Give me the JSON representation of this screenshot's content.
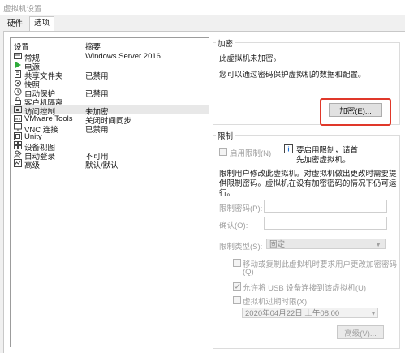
{
  "window": {
    "title": "虚拟机设置"
  },
  "tabs": [
    {
      "label": "硬件"
    },
    {
      "label": "选项"
    }
  ],
  "device_list": {
    "headers": {
      "setting": "设置",
      "summary": "摘要"
    },
    "items": [
      {
        "name": "常规",
        "summary": "Windows Server 2016",
        "icon": "general-icon"
      },
      {
        "name": "电源",
        "summary": "",
        "icon": "power-icon"
      },
      {
        "name": "共享文件夹",
        "summary": "已禁用",
        "icon": "shared-folders-icon"
      },
      {
        "name": "快照",
        "summary": "",
        "icon": "snapshot-icon"
      },
      {
        "name": "自动保护",
        "summary": "已禁用",
        "icon": "autoprotect-icon"
      },
      {
        "name": "客户机隔离",
        "summary": "",
        "icon": "lock-icon"
      },
      {
        "name": "访问控制",
        "summary": "未加密",
        "icon": "access-control-icon",
        "selected": true
      },
      {
        "name": "VMware Tools",
        "summary": "关闭时间同步",
        "icon": "vmware-tools-icon"
      },
      {
        "name": "VNC 连接",
        "summary": "已禁用",
        "icon": "vnc-icon"
      },
      {
        "name": "Unity",
        "summary": "",
        "icon": "unity-icon"
      },
      {
        "name": "设备视图",
        "summary": "",
        "icon": "device-view-icon"
      },
      {
        "name": "自动登录",
        "summary": "不可用",
        "icon": "autologin-icon"
      },
      {
        "name": "高级",
        "summary": "默认/默认",
        "icon": "advanced-icon"
      }
    ]
  },
  "encryption": {
    "group_label": "加密",
    "status": "此虚拟机未加密。",
    "description": "您可以通过密码保护虚拟机的数据和配置。",
    "encrypt_button": "加密(E)..."
  },
  "restrictions": {
    "group_label": "限制",
    "enable_label": "启用限制(N)",
    "info_line1": "要启用限制，请首",
    "info_line2": "先加密虚拟机。",
    "desc_line1": "限制用户修改此虚拟机。对虚拟机做出更改时需要提",
    "desc_line2": "供限制密码。虚拟机在设有加密密码的情况下仍可运",
    "desc_line3": "行。",
    "password_label": "限制密码(P):",
    "confirm_label": "确认(O):",
    "type_label": "限制类型(S):",
    "type_value": "固定",
    "move_copy_line1": "移动或复制此虚拟机时要求用户更改加密密码",
    "move_copy_line2": "(Q)",
    "usb_label": "允许将 USB 设备连接到该虚拟机(U)",
    "expire_label": "虚拟机过期时限(X):",
    "expire_value": "2020年04月22日 上午08:00",
    "advanced_button": "高级(V)..."
  },
  "colors": {
    "highlight_box": "#e0382a",
    "selected_row": "#e8e8e8",
    "play_icon": "#2eaa3a"
  }
}
